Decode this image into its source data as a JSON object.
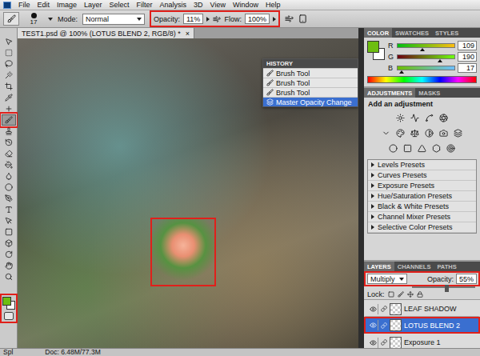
{
  "menu": {
    "items": [
      "File",
      "Edit",
      "Image",
      "Layer",
      "Select",
      "Filter",
      "Analysis",
      "3D",
      "View",
      "Window",
      "Help"
    ]
  },
  "options": {
    "brush_size": "17",
    "mode_label": "Mode:",
    "mode": "Normal",
    "opacity_label": "Opacity:",
    "opacity": "11%",
    "flow_label": "Flow:",
    "flow": "100%",
    "highlighted": true
  },
  "tools": [
    {
      "selected": false,
      "highlighted": false
    },
    {
      "selected": false,
      "highlighted": false
    },
    {
      "selected": false,
      "highlighted": false
    },
    {
      "selected": false,
      "highlighted": false
    },
    {
      "selected": false,
      "highlighted": false
    },
    {
      "selected": false,
      "highlighted": false
    },
    {
      "selected": false,
      "highlighted": false
    },
    {
      "selected": true,
      "highlighted": true
    },
    {
      "selected": false,
      "highlighted": false
    },
    {
      "selected": false,
      "highlighted": false
    },
    {
      "selected": false,
      "highlighted": false
    },
    {
      "selected": false,
      "highlighted": false
    },
    {
      "selected": false,
      "highlighted": false
    },
    {
      "selected": false,
      "highlighted": false
    },
    {
      "selected": false,
      "highlighted": false
    },
    {
      "selected": false,
      "highlighted": false
    },
    {
      "selected": false,
      "highlighted": false
    },
    {
      "selected": false,
      "highlighted": false
    },
    {
      "selected": false,
      "highlighted": false
    },
    {
      "selected": false,
      "highlighted": false
    },
    {
      "selected": false,
      "highlighted": false
    },
    {
      "selected": false,
      "highlighted": false
    }
  ],
  "swatches": {
    "highlighted": true
  },
  "document": {
    "tab": "TEST1.psd @ 100% (LOTUS BLEND 2, RGB/8) *",
    "close": "×"
  },
  "canvas": {
    "highlighted": true
  },
  "history": {
    "title": "HISTORY",
    "items": [
      {
        "label": "Brush Tool",
        "kind": "brush",
        "selected": false
      },
      {
        "label": "Brush Tool",
        "kind": "brush",
        "selected": false
      },
      {
        "label": "Brush Tool",
        "kind": "brush",
        "selected": false
      },
      {
        "label": "Master Opacity Change",
        "kind": "opacity",
        "selected": true
      }
    ]
  },
  "color_panel": {
    "tabs": [
      {
        "label": "COLOR",
        "selected": true
      },
      {
        "label": "SWATCHES",
        "selected": false
      },
      {
        "label": "STYLES",
        "selected": false
      }
    ],
    "channels": [
      {
        "name": "R",
        "value": "109",
        "level": 0.43
      },
      {
        "name": "G",
        "value": "190",
        "level": 0.75
      },
      {
        "name": "B",
        "value": "17",
        "level": 0.07
      }
    ]
  },
  "adjustments": {
    "tabs": [
      {
        "label": "ADJUSTMENTS",
        "selected": true
      },
      {
        "label": "MASKS",
        "selected": false
      }
    ],
    "hint": "Add an adjustment",
    "presets": [
      "Levels Presets",
      "Curves Presets",
      "Exposure Presets",
      "Hue/Saturation Presets",
      "Black & White Presets",
      "Channel Mixer Presets",
      "Selective Color Presets"
    ]
  },
  "layers": {
    "tabs": [
      {
        "label": "LAYERS",
        "selected": true
      },
      {
        "label": "CHANNELS",
        "selected": false
      },
      {
        "label": "PATHS",
        "selected": false
      }
    ],
    "blend_mode": "Multiply",
    "opacity_label": "Opacity:",
    "opacity": "55%",
    "opacity_level": 0.55,
    "lock_label": "Lock:",
    "highlighted": true,
    "items": [
      {
        "name": "LEAF SHADOW",
        "visible": true,
        "selected": false,
        "highlighted": false
      },
      {
        "name": "LOTUS BLEND 2",
        "visible": true,
        "selected": true,
        "highlighted": true
      },
      {
        "name": "Exposure 1",
        "visible": true,
        "selected": false,
        "highlighted": false
      }
    ]
  },
  "status_bar": {
    "zoom": "Spl",
    "doc": "Doc: 6.48M/77.3M"
  }
}
